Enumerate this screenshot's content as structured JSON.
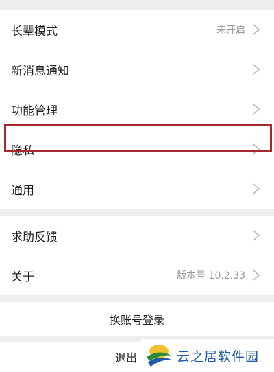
{
  "settings": {
    "items": [
      {
        "label": "长辈模式",
        "value": "未开启",
        "chevron": "chevron-right-icon"
      },
      {
        "label": "新消息通知",
        "value": "",
        "chevron": "chevron-right-icon"
      },
      {
        "label": "功能管理",
        "value": "",
        "chevron": "chevron-right-icon"
      },
      {
        "label": "隐私",
        "value": "",
        "chevron": "chevron-right-icon"
      },
      {
        "label": "通用",
        "value": "",
        "chevron": "chevron-right-icon"
      }
    ],
    "support_items": [
      {
        "label": "求助反馈",
        "value": "",
        "chevron": "chevron-right-icon"
      },
      {
        "label": "关于",
        "value": "版本号 10.2.33",
        "chevron": "chevron-right-icon"
      }
    ],
    "switch_account_label": "换账号登录",
    "logout_label": "退出"
  },
  "highlight_color": "#a8272b",
  "watermark": {
    "text": "云之居软件园"
  }
}
